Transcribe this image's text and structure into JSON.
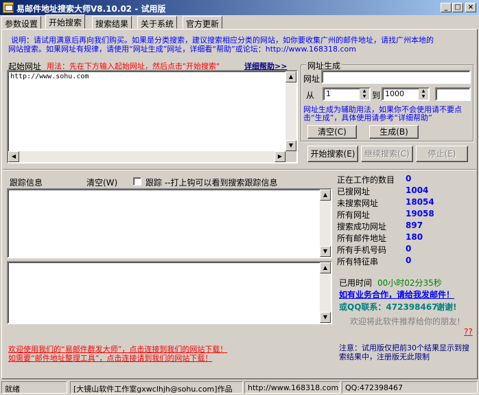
{
  "window": {
    "title": "易邮件地址搜索大师V8.10.02 - 试用版",
    "btn_min": "_",
    "btn_max": "□",
    "btn_close": "×"
  },
  "tabs": [
    "参数设置",
    "开始搜索",
    "搜索结果",
    "关于系统",
    "官方更新"
  ],
  "notice": {
    "line1": "说明：请试用满意后再向我们购买。如果是分类搜索，建议搜索相应分类的网站，如你要收集广州的邮件地址，请找广州本地的",
    "line2": "网站搜索。如果网址有规律，请使用“网址生成”网址，详细看“帮助”或论坛：http://www.168318.com"
  },
  "start_url": {
    "label": "起始网址",
    "usage": "用法：先在下方输入起始网址，然后点击\"开始搜索\"",
    "help_link": "详细帮助>>",
    "value": "http://www.sohu.com"
  },
  "url_gen": {
    "group_title": "网址生成",
    "url_label": "网址",
    "url_value": "",
    "from_label": "从",
    "from_value": "1",
    "to_label": "到",
    "to_value": "1000",
    "extra_value": "",
    "desc": "网址生成为辅助用法，如果你不会使用请不要点击“生成”，具体使用请参考“详细帮助”",
    "clear_button": "清空(C)",
    "generate_button": "生成(B)"
  },
  "actions": {
    "start": "开始搜索(E)",
    "continue": "继续搜索(C)",
    "stop": "停止(E)"
  },
  "trace": {
    "label": "跟踪信息",
    "clear": "清空(W)",
    "checkbox_label": "跟踪 --打上钩可以看到搜索跟踪信息"
  },
  "stats": [
    {
      "label": "正在工作的数目",
      "value": "0"
    },
    {
      "label": "已搜网址",
      "value": "1004"
    },
    {
      "label": "未搜索网址",
      "value": "18054"
    },
    {
      "label": "所有网址",
      "value": "19058"
    },
    {
      "label": "搜索成功网址",
      "value": "897"
    },
    {
      "label": "所有邮件地址",
      "value": "180"
    },
    {
      "label": "所有手机号码",
      "value": "0"
    },
    {
      "label": "所有特征串",
      "value": "0"
    }
  ],
  "elapsed": {
    "label": "已用时间",
    "value": "00小时02分35秒"
  },
  "contact": {
    "coop": "如有业务合作，请给我发邮件！",
    "qq": "或QQ联系：472398467",
    "thanks": "谢谢!",
    "recommend": "欢迎将此软件推荐给你的朋友!",
    "question": "??"
  },
  "promo": {
    "line1": "欢迎使用我们的“易邮件群发大师”，点击连接到我们的网站下载！",
    "line2": "如需要“邮件地址整理工具”，点击连接请到我们的网站下载！"
  },
  "trial_note": "注意：试用版仅把前30个结果显示到搜索结果中，注册版无此限制",
  "statusbar": {
    "ready": "就绪",
    "studio": "[大镜山软件工作室gxwclhjh@sohu.com]作品",
    "website": "http://www.168318.com",
    "qq": "QQ:472398467"
  },
  "colors": {
    "title_start": "#0a246a",
    "title_end": "#a6caf0",
    "link_blue": "#0000ff",
    "promo_red": "#ff0000",
    "elapsed_green": "#008000",
    "contact_navy": "#000080"
  }
}
